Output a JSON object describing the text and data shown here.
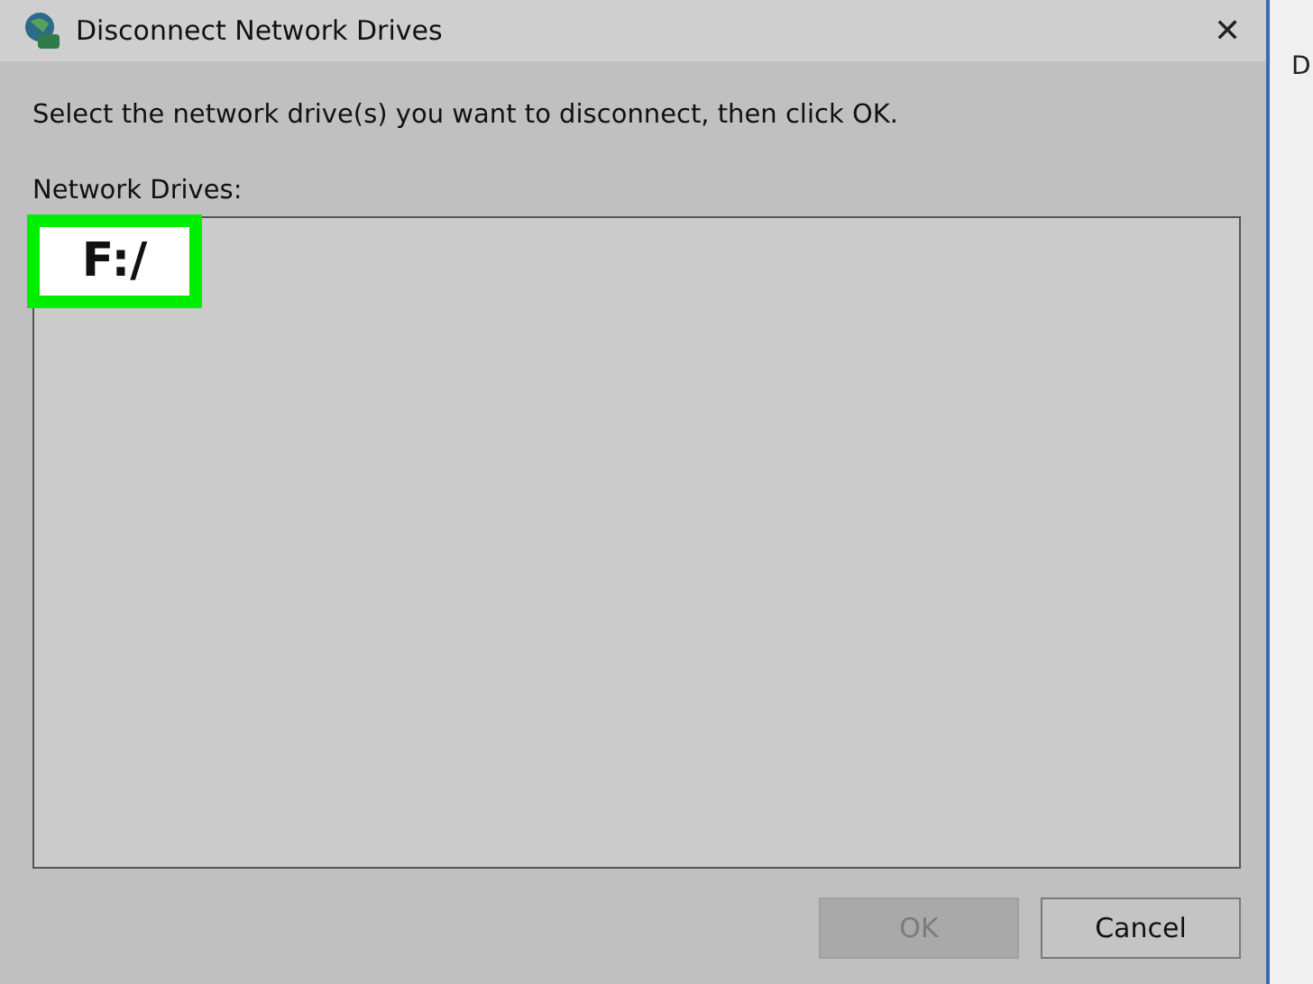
{
  "window": {
    "title": "Disconnect Network Drives",
    "close": "✕"
  },
  "instruction": "Select the network drive(s) you want to disconnect, then click OK.",
  "list_label": "Network Drives:",
  "drives": [
    {
      "label": "F:/",
      "highlighted": true
    }
  ],
  "buttons": [
    {
      "label": "OK",
      "disabled": true
    },
    {
      "label": "Cancel",
      "disabled": false
    }
  ],
  "background_window": {
    "text": "D"
  }
}
